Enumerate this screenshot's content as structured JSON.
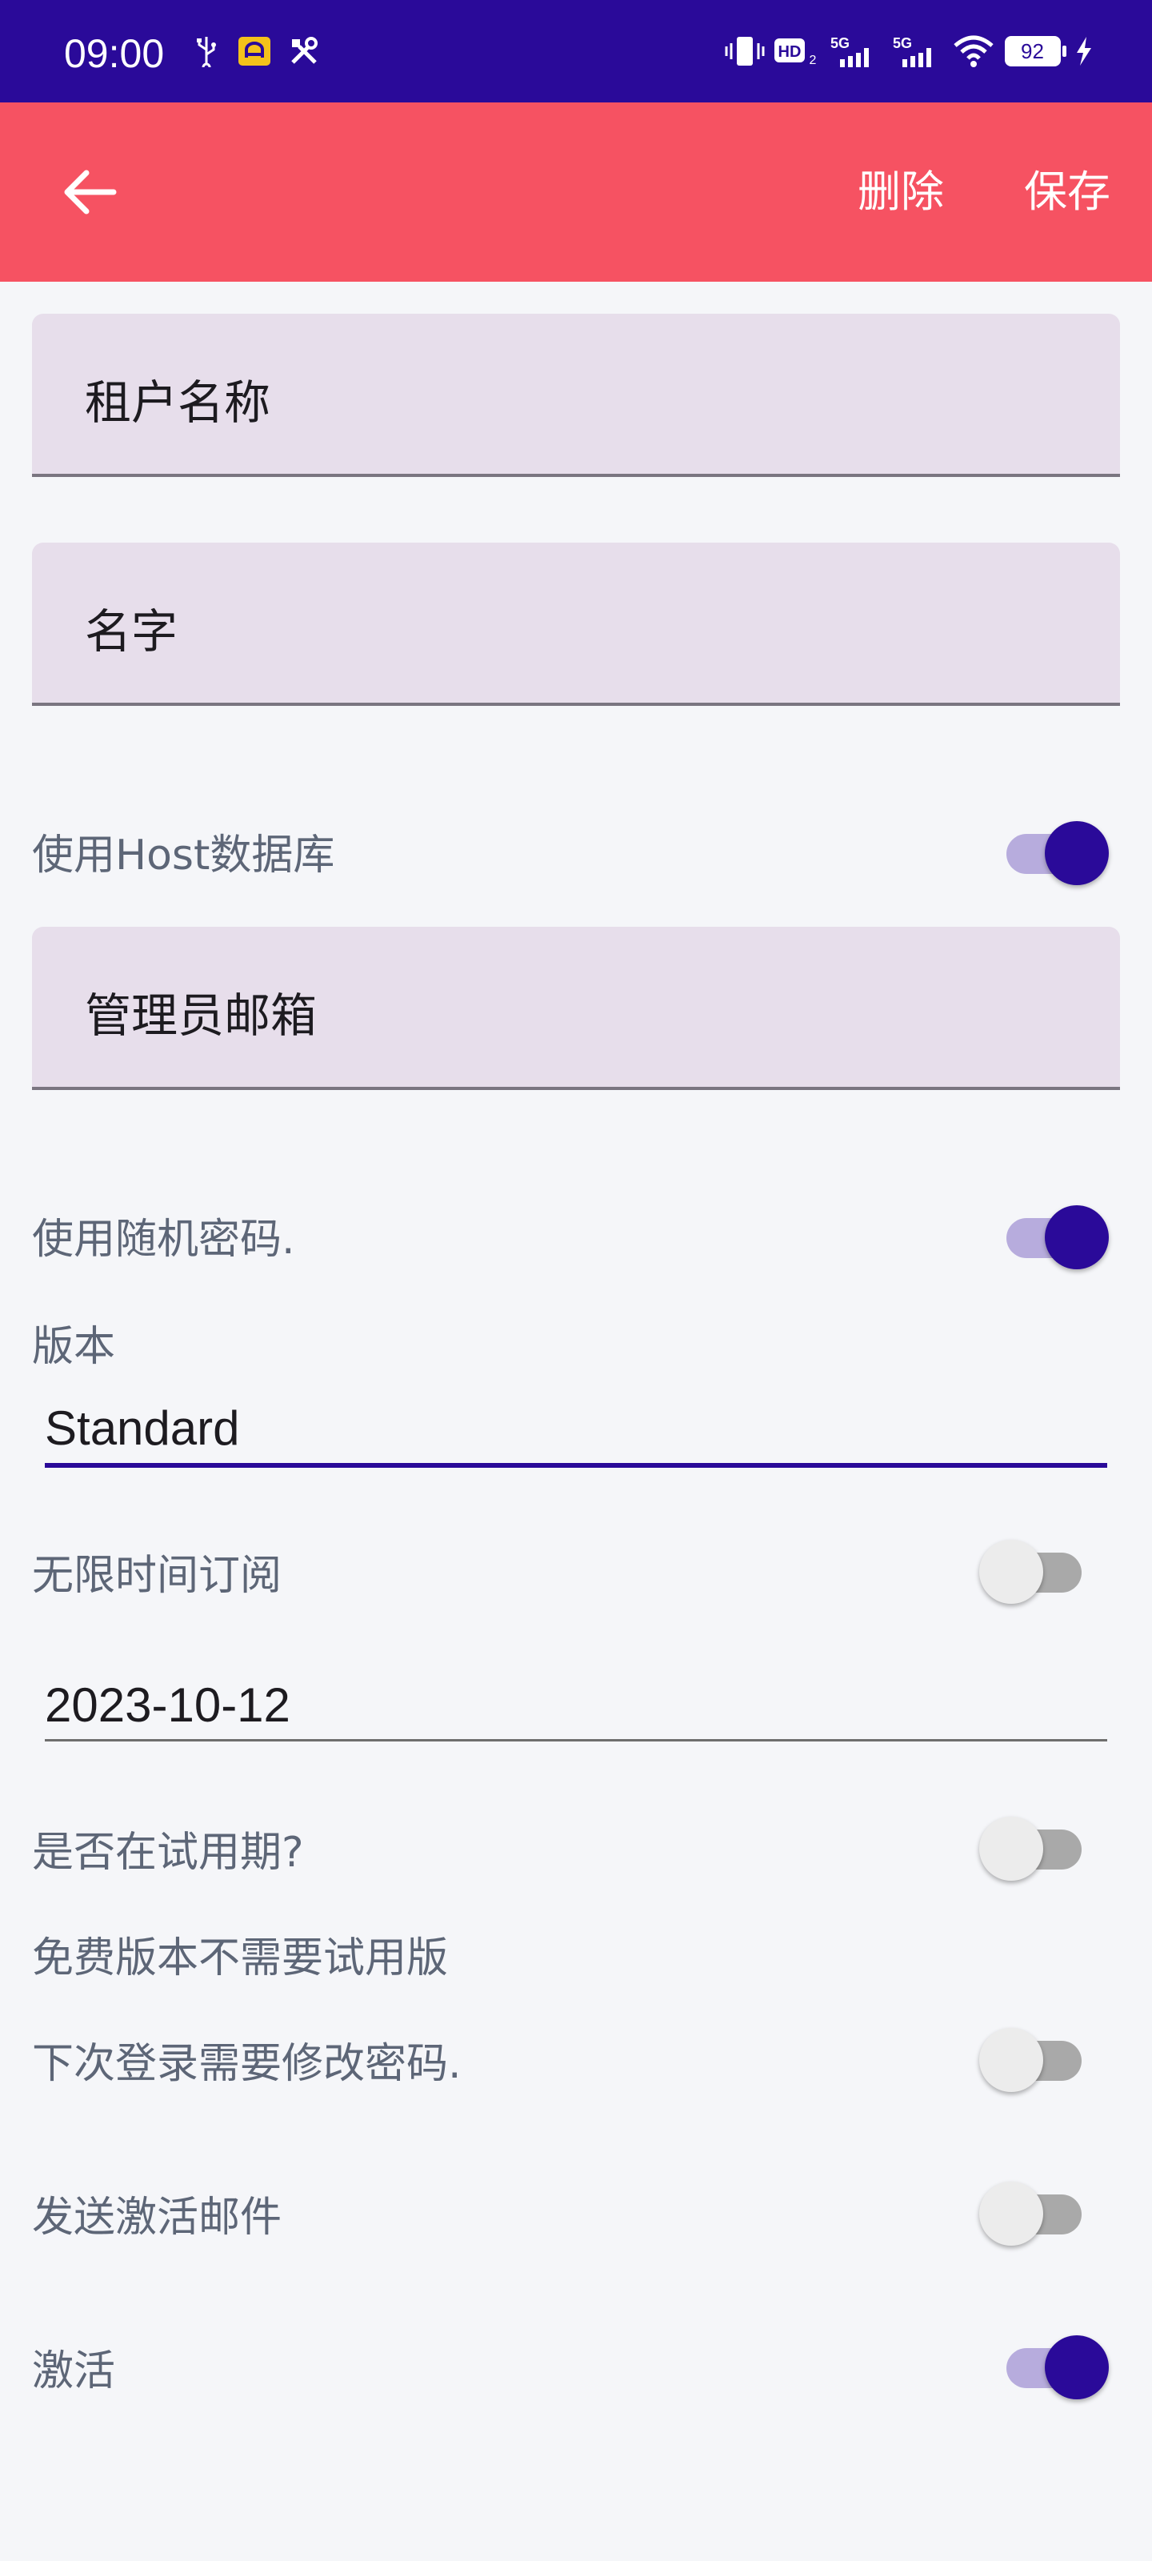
{
  "status_bar": {
    "time": "09:00",
    "battery": "92",
    "network_a": "5G",
    "network_b": "5G",
    "hd_badge": "HD"
  },
  "app_bar": {
    "delete_label": "删除",
    "save_label": "保存"
  },
  "form": {
    "tenant_name": {
      "placeholder": "租户名称"
    },
    "name": {
      "placeholder": "名字"
    },
    "use_host_db": {
      "label": "使用Host数据库",
      "checked": true
    },
    "admin_email": {
      "placeholder": "管理员邮箱"
    },
    "random_password": {
      "label": "使用随机密码.",
      "checked": true
    },
    "edition": {
      "label": "版本",
      "value": "Standard"
    },
    "unlimited_subscription": {
      "label": "无限时间订阅",
      "checked": false
    },
    "subscription_end": {
      "value": "2023-10-12"
    },
    "trial": {
      "label": "是否在试用期?",
      "checked": false
    },
    "trial_note": "免费版本不需要试用版",
    "change_password_next_login": {
      "label": "下次登录需要修改密码.",
      "checked": false
    },
    "send_activation_email": {
      "label": "发送激活邮件",
      "checked": false
    },
    "active": {
      "label": "激活",
      "checked": true
    }
  },
  "colors": {
    "status_bar": "#2A0A99",
    "app_bar": "#F65262",
    "accent": "#2A0A99",
    "field_bg": "#E7DEEB"
  }
}
